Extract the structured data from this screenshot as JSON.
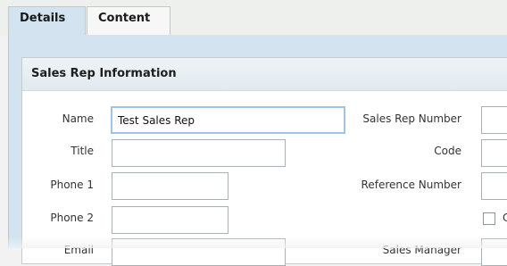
{
  "tabs": [
    {
      "label": "Details",
      "active": true
    },
    {
      "label": "Content",
      "active": false
    }
  ],
  "section": {
    "title": "Sales Rep Information"
  },
  "fields": {
    "name": {
      "label": "Name",
      "value": "Test Sales Rep"
    },
    "title": {
      "label": "Title",
      "value": ""
    },
    "phone1": {
      "label": "Phone 1",
      "value": ""
    },
    "phone2": {
      "label": "Phone 2",
      "value": ""
    },
    "email": {
      "label": "Email",
      "value": ""
    },
    "sales_rep_number": {
      "label": "Sales Rep Number",
      "value": ""
    },
    "code": {
      "label": "Code",
      "value": ""
    },
    "reference_number": {
      "label": "Reference Number",
      "value": ""
    },
    "checkbox_partial": {
      "label": "C",
      "checked": false
    },
    "sales_manager": {
      "label": "Sales Manager",
      "value": ""
    }
  },
  "colors": {
    "panel": "#d3e3f0",
    "focus_border": "#9ec4e6"
  }
}
